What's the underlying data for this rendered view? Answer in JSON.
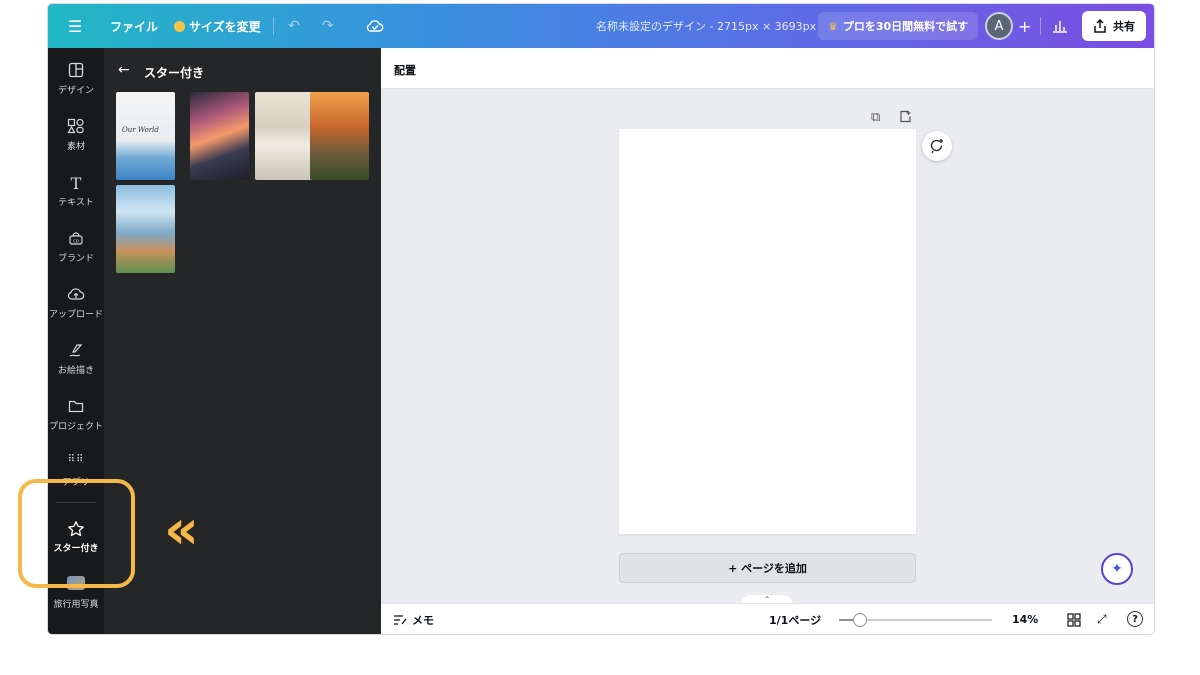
{
  "topbar": {
    "menu_icon": "hamburger-icon",
    "file_label": "ファイル",
    "resize_label": "サイズを変更",
    "doc_title": "名称未設定のデザイン - 2715px × 3693px",
    "pro_label": "プロを30日間無料で試す",
    "avatar_letter": "A",
    "share_label": "共有",
    "colors": {
      "gradient_start": "#22b8c5",
      "gradient_end": "#7b4ee2"
    }
  },
  "rail": {
    "items": [
      {
        "label": "デザイン",
        "icon": "layout-icon"
      },
      {
        "label": "素材",
        "icon": "shapes-icon"
      },
      {
        "label": "テキスト",
        "icon": "text-icon"
      },
      {
        "label": "ブランド",
        "icon": "brand-icon"
      },
      {
        "label": "アップロード",
        "icon": "cloud-upload-icon"
      },
      {
        "label": "お絵描き",
        "icon": "draw-icon"
      },
      {
        "label": "プロジェクト",
        "icon": "folder-icon"
      },
      {
        "label": "アプリ",
        "icon": "apps-grid-icon"
      },
      {
        "label": "スター付き",
        "icon": "star-icon",
        "active": true
      },
      {
        "label": "旅行用写真",
        "icon": "photo-thumbnail-icon"
      }
    ]
  },
  "panel": {
    "title": "スター付き",
    "template_text": "Our World"
  },
  "editor": {
    "context_label": "配置",
    "add_page_label": "+ ページを追加"
  },
  "bottombar": {
    "notes_label": "メモ",
    "page_count": "1/1ページ",
    "zoom": "14%",
    "zoom_fraction": 0.14
  },
  "annotation": {
    "color": "#f7b84a",
    "arrow_glyph": "«"
  }
}
